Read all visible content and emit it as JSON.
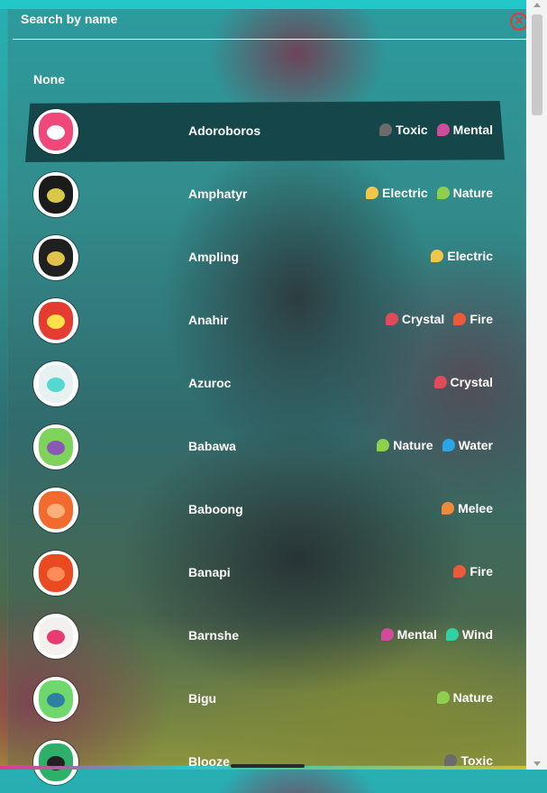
{
  "search": {
    "label": "Search by name"
  },
  "none_option": "None",
  "close_icon": "close-circle-icon",
  "type_colors": {
    "Toxic": "#6b6b6b",
    "Mental": "#d04c9a",
    "Electric": "#f2c64a",
    "Nature": "#8fcf4f",
    "Crystal": "#e24a5a",
    "Fire": "#ec5a3a",
    "Water": "#2aa7e6",
    "Melee": "#f08a3a",
    "Wind": "#2fd2a4"
  },
  "items": [
    {
      "name": "Adoroboros",
      "selected": true,
      "avatar_colors": [
        "#f0487a",
        "#ffffff"
      ],
      "types": [
        "Toxic",
        "Mental"
      ]
    },
    {
      "name": "Amphatyr",
      "avatar_colors": [
        "#1b1b1b",
        "#d8c84a"
      ],
      "types": [
        "Electric",
        "Nature"
      ]
    },
    {
      "name": "Ampling",
      "avatar_colors": [
        "#202020",
        "#e0c34a"
      ],
      "types": [
        "Electric"
      ]
    },
    {
      "name": "Anahir",
      "avatar_colors": [
        "#e43c30",
        "#ffe04a"
      ],
      "types": [
        "Crystal",
        "Fire"
      ]
    },
    {
      "name": "Azuroc",
      "avatar_colors": [
        "#e7f1f1",
        "#54d8d0"
      ],
      "types": [
        "Crystal"
      ]
    },
    {
      "name": "Babawa",
      "avatar_colors": [
        "#7ed35a",
        "#8a59b8"
      ],
      "types": [
        "Nature",
        "Water"
      ]
    },
    {
      "name": "Baboong",
      "avatar_colors": [
        "#f26a2d",
        "#ffb07a"
      ],
      "types": [
        "Melee"
      ]
    },
    {
      "name": "Banapi",
      "avatar_colors": [
        "#ea4a20",
        "#ff8a5a"
      ],
      "types": [
        "Fire"
      ]
    },
    {
      "name": "Barnshe",
      "avatar_colors": [
        "#f4f0f0",
        "#e63c70"
      ],
      "types": [
        "Mental",
        "Wind"
      ]
    },
    {
      "name": "Bigu",
      "avatar_colors": [
        "#6fd86c",
        "#2f7fa0"
      ],
      "types": [
        "Nature"
      ]
    },
    {
      "name": "Blooze",
      "avatar_colors": [
        "#2db06a",
        "#222222"
      ],
      "types": [
        "Toxic"
      ]
    }
  ]
}
